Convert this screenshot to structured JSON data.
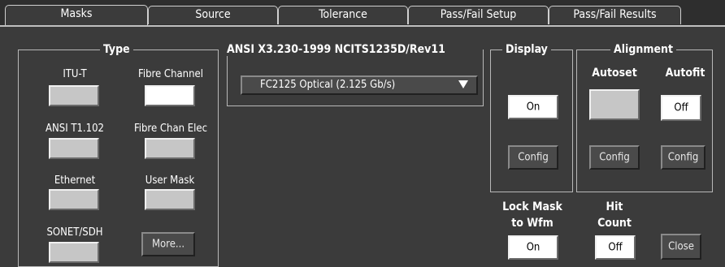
{
  "tabs": [
    {
      "label": "Masks"
    },
    {
      "label": "Source"
    },
    {
      "label": "Tolerance"
    },
    {
      "label": "Pass/Fail Setup"
    },
    {
      "label": "Pass/Fail Results"
    }
  ],
  "type_group": {
    "title": "Type",
    "itu_t": "ITU-T",
    "fibre_channel": "Fibre Channel",
    "ansi_t1": "ANSI T1.102",
    "fibre_chan_elec": "Fibre Chan Elec",
    "ethernet": "Ethernet",
    "user_mask": "User Mask",
    "sonet_sdh": "SONET/SDH",
    "more": "More..."
  },
  "standard": {
    "title": "ANSI X3.230-1999 NCITS1235D/Rev11",
    "selected": "FC2125 Optical (2.125 Gb/s)"
  },
  "display": {
    "title": "Display",
    "toggle": "On",
    "config": "Config"
  },
  "alignment": {
    "title": "Alignment",
    "autoset": "Autoset",
    "autofit": "Autofit",
    "autofit_toggle": "Off",
    "config1": "Config",
    "config2": "Config"
  },
  "lock_mask": {
    "line1": "Lock Mask",
    "line2": "to Wfm",
    "toggle": "On"
  },
  "hit_count": {
    "line1": "Hit",
    "line2": "Count",
    "toggle": "Off"
  },
  "close": "Close"
}
